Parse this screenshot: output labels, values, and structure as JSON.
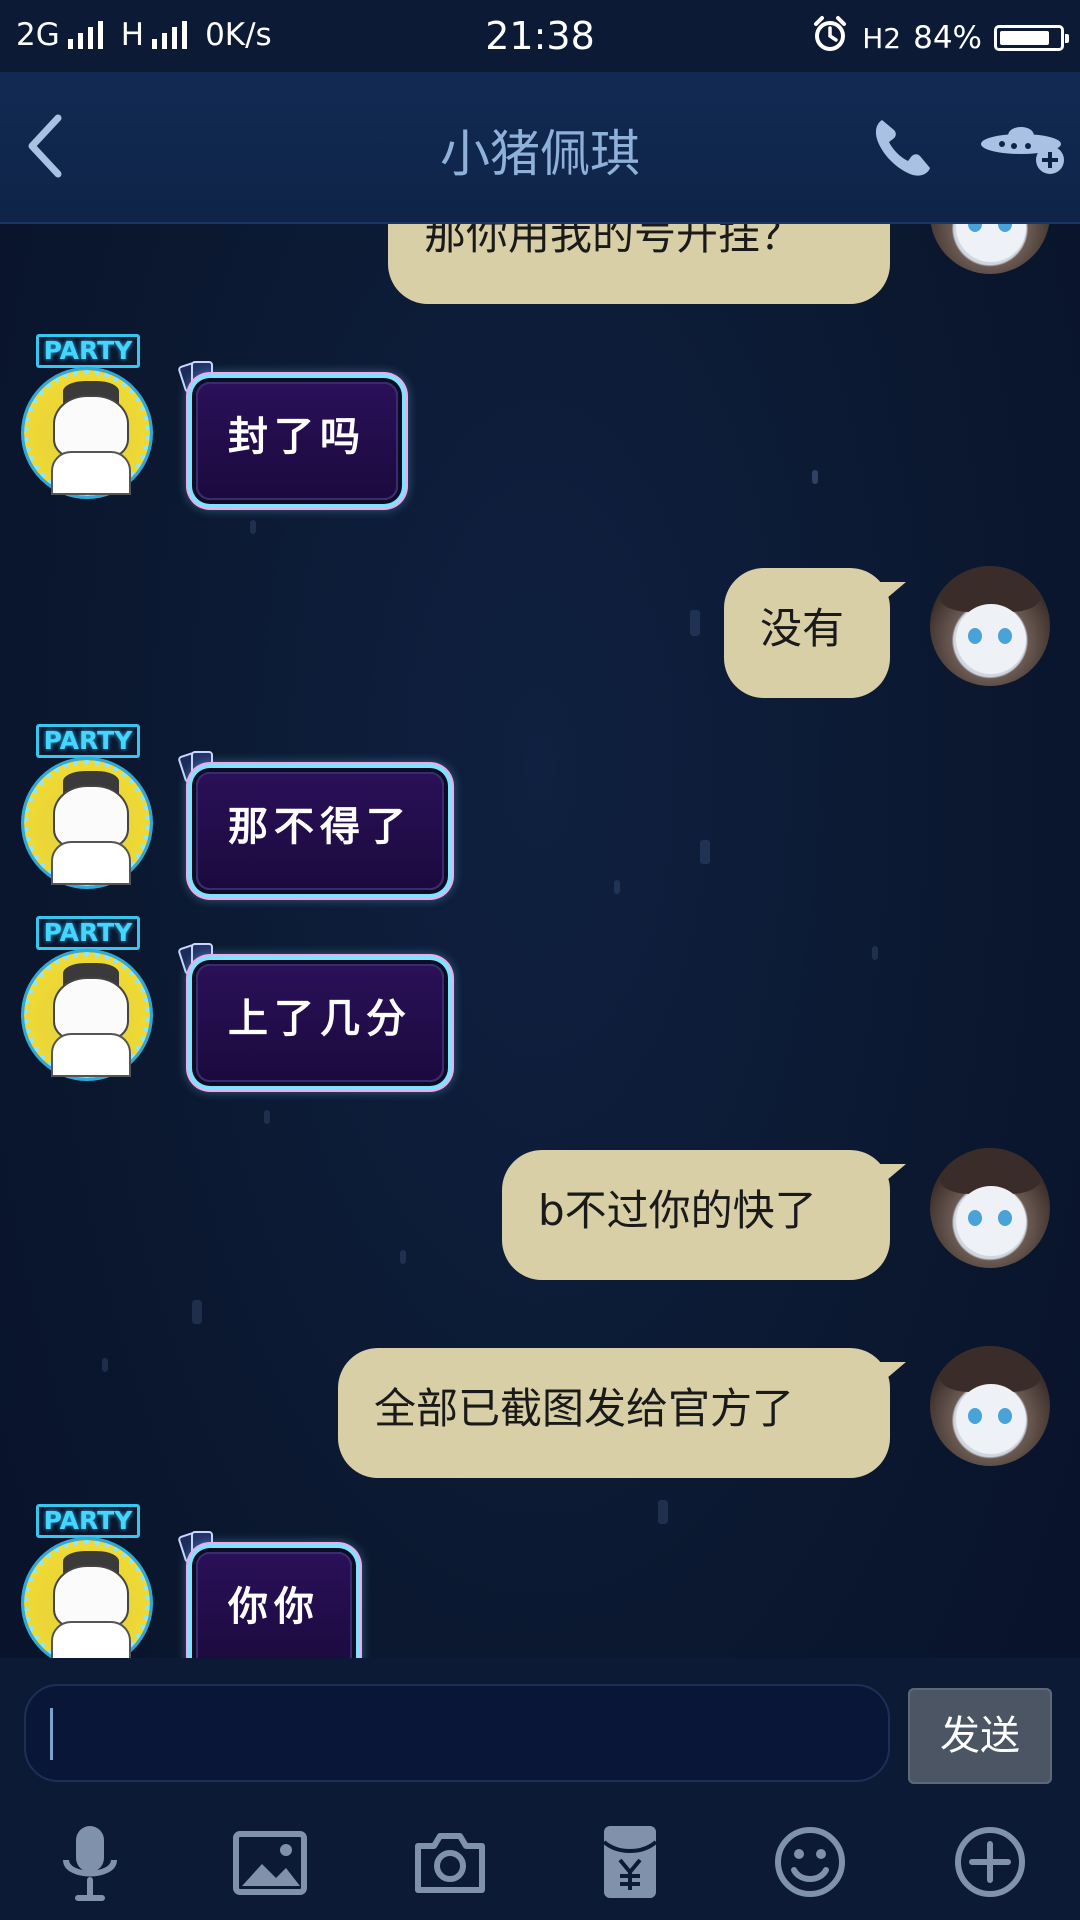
{
  "status_bar": {
    "network_left": "2G",
    "network_mid": "H",
    "speed": "0K/s",
    "time": "21:38",
    "h2_label": "H2",
    "battery_percent": "84%",
    "battery_level": 0.84
  },
  "header": {
    "title": "小猪佩琪"
  },
  "messages": [
    {
      "side": "me",
      "text": "那你用我的号开挂？"
    },
    {
      "side": "other",
      "text": "封了吗",
      "badge": "PARTY"
    },
    {
      "side": "me",
      "text": "没有"
    },
    {
      "side": "other",
      "text": "那不得了",
      "badge": "PARTY"
    },
    {
      "side": "other",
      "text": "上了几分",
      "badge": "PARTY"
    },
    {
      "side": "me",
      "text": "b不过你的快了"
    },
    {
      "side": "me",
      "text": "全部已截图发给官方了"
    },
    {
      "side": "other",
      "text": "你你",
      "badge": "PARTY"
    }
  ],
  "input": {
    "value": "",
    "send_label": "发送"
  },
  "toolbar": {
    "items": [
      "microphone-icon",
      "image-icon",
      "camera-icon",
      "red-packet-icon",
      "emoji-icon",
      "plus-circle-icon"
    ]
  },
  "colors": {
    "bubble_me": "#d8cfa6",
    "bubble_party": "#2a1058",
    "title_text": "#8fb0d9",
    "background": "#0b1730"
  }
}
